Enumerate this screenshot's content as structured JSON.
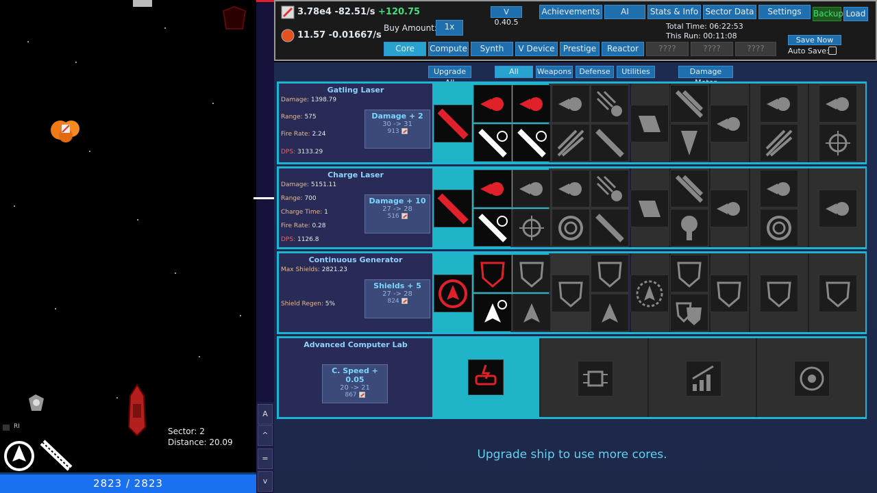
{
  "game": {
    "sector_label": "Sector: 2",
    "distance_label": "Distance: 20.09",
    "hp": "2823 / 2823",
    "ri_label": "RI"
  },
  "strip": {
    "buttons": [
      "A",
      "^",
      "=",
      "v"
    ]
  },
  "top": {
    "resource1": {
      "value": "3.78e4",
      "rate": "-82.51/s",
      "gain": "+120.75"
    },
    "resource2": {
      "value": "11.57",
      "rate": "-0.01667/s"
    },
    "buy_amount_label": "Buy Amount:",
    "buy_amount_value": "1x",
    "version": "V 0.40.5",
    "nav": [
      "Achievements",
      "AI",
      "Stats & Info",
      "Sector Data",
      "Settings"
    ],
    "backup": "Backup",
    "load": "Load",
    "total_time": "Total Time: 06:22:53",
    "this_run": "This Run: 00:11:08",
    "save_now": "Save Now",
    "auto_save": "Auto Save:",
    "tabs": [
      "Core",
      "Compute",
      "Synth",
      "V Device",
      "Prestige",
      "Reactor",
      "????",
      "????",
      "????"
    ]
  },
  "filters": {
    "upgrade_all": "Upgrade All",
    "items": [
      "All",
      "Weapons",
      "Defense",
      "Utilities"
    ],
    "damage_meter": "Damage Meter"
  },
  "modules": [
    {
      "title": "Gatling Laser",
      "stats": [
        {
          "k": "Damage:",
          "v": "1398.79"
        },
        {
          "k": "Range:",
          "v": "575"
        },
        {
          "k": "Fire Rate:",
          "v": "2.24"
        },
        {
          "k": "DPS:",
          "v": "3133.29"
        }
      ],
      "upgrade": {
        "label": "Damage + 2",
        "change": "30 -> 31",
        "cost": "913"
      }
    },
    {
      "title": "Charge Laser",
      "stats": [
        {
          "k": "Damage:",
          "v": "5151.11"
        },
        {
          "k": "Range:",
          "v": "700"
        },
        {
          "k": "Charge Time:",
          "v": "1"
        },
        {
          "k": "Fire Rate:",
          "v": "0.28"
        },
        {
          "k": "DPS:",
          "v": "1126.8"
        }
      ],
      "upgrade": {
        "label": "Damage + 10",
        "change": "27 -> 28",
        "cost": "516"
      }
    },
    {
      "title": "Continuous Generator",
      "stats": [
        {
          "k": "Max Shields:",
          "v": "2821.23"
        },
        {
          "k": "Shield Regen:",
          "v": "5%"
        }
      ],
      "upgrade": {
        "label": "Shields + 5",
        "change": "27 -> 28",
        "cost": "824"
      }
    },
    {
      "title": "Advanced Computer Lab",
      "stats": [],
      "upgrade": {
        "label": "C. Speed + 0.05",
        "change": "20 -> 21",
        "cost": "867"
      }
    }
  ],
  "upgrade_message": "Upgrade ship to use more cores.",
  "colors": {
    "accent": "#1fb4d3",
    "button": "#1f6fae",
    "positive": "#3fe07a",
    "danger": "#e0212b"
  }
}
